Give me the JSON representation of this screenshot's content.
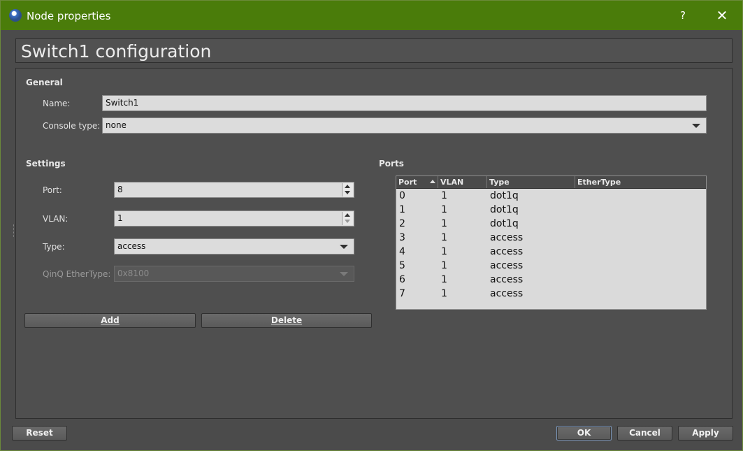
{
  "window": {
    "title": "Node properties",
    "help": "?",
    "close": "✕"
  },
  "header": {
    "title": "Switch1 configuration"
  },
  "general": {
    "title": "General",
    "name_label": "Name:",
    "name_value": "Switch1",
    "console_label": "Console type:",
    "console_value": "none"
  },
  "settings": {
    "title": "Settings",
    "port_label": "Port:",
    "port_value": "8",
    "vlan_label": "VLAN:",
    "vlan_value": "1",
    "type_label": "Type:",
    "type_value": "access",
    "qinq_label": "QinQ EtherType:",
    "qinq_value": "0x8100"
  },
  "buttons": {
    "add": "Add",
    "delete": "Delete",
    "reset": "Reset",
    "ok": "OK",
    "cancel": "Cancel",
    "apply": "Apply"
  },
  "ports": {
    "title": "Ports",
    "columns": [
      "Port",
      "VLAN",
      "Type",
      "EtherType"
    ],
    "rows": [
      [
        "0",
        "1",
        "dot1q",
        ""
      ],
      [
        "1",
        "1",
        "dot1q",
        ""
      ],
      [
        "2",
        "1",
        "dot1q",
        ""
      ],
      [
        "3",
        "1",
        "access",
        ""
      ],
      [
        "4",
        "1",
        "access",
        ""
      ],
      [
        "5",
        "1",
        "access",
        ""
      ],
      [
        "6",
        "1",
        "access",
        ""
      ],
      [
        "7",
        "1",
        "access",
        ""
      ]
    ]
  },
  "colors": {
    "titlebar": "#4a7c0a",
    "panel": "#4f4f4f",
    "field": "#dcdcdc"
  },
  "icons": {
    "app": "gns3-app-icon",
    "help": "help-icon",
    "close": "close-icon"
  }
}
